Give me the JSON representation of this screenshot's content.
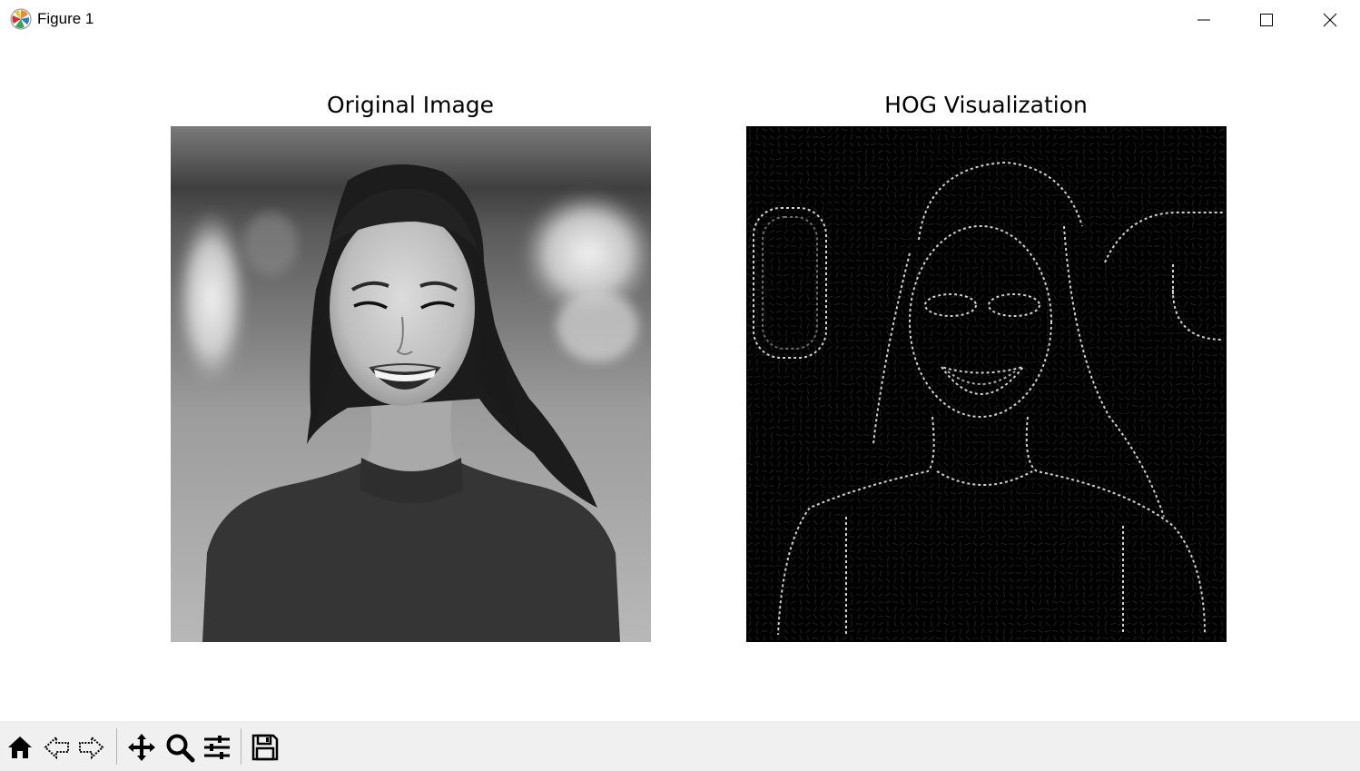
{
  "window": {
    "title": "Figure 1",
    "icons": {
      "app": "matplotlib-icon",
      "minimize": "minimize-icon",
      "maximize": "maximize-icon",
      "close": "close-icon"
    }
  },
  "figure": {
    "subplots": [
      {
        "title": "Original Image",
        "content": "grayscale portrait photo"
      },
      {
        "title": "HOG Visualization",
        "content": "HOG gradient visualization on black"
      }
    ]
  },
  "toolbar": {
    "buttons": [
      {
        "icon": "home-icon",
        "action": "Home"
      },
      {
        "icon": "back-arrow-icon",
        "action": "Back"
      },
      {
        "icon": "forward-arrow-icon",
        "action": "Forward"
      },
      {
        "icon": "pan-move-icon",
        "action": "Pan"
      },
      {
        "icon": "zoom-magnifier-icon",
        "action": "Zoom"
      },
      {
        "icon": "configure-subplots-icon",
        "action": "Configure subplots"
      },
      {
        "icon": "save-disk-icon",
        "action": "Save"
      }
    ]
  },
  "colors": {
    "window_bg": "#ffffff",
    "toolbar_bg": "#f0f0f0",
    "hog_bg": "#000000"
  }
}
